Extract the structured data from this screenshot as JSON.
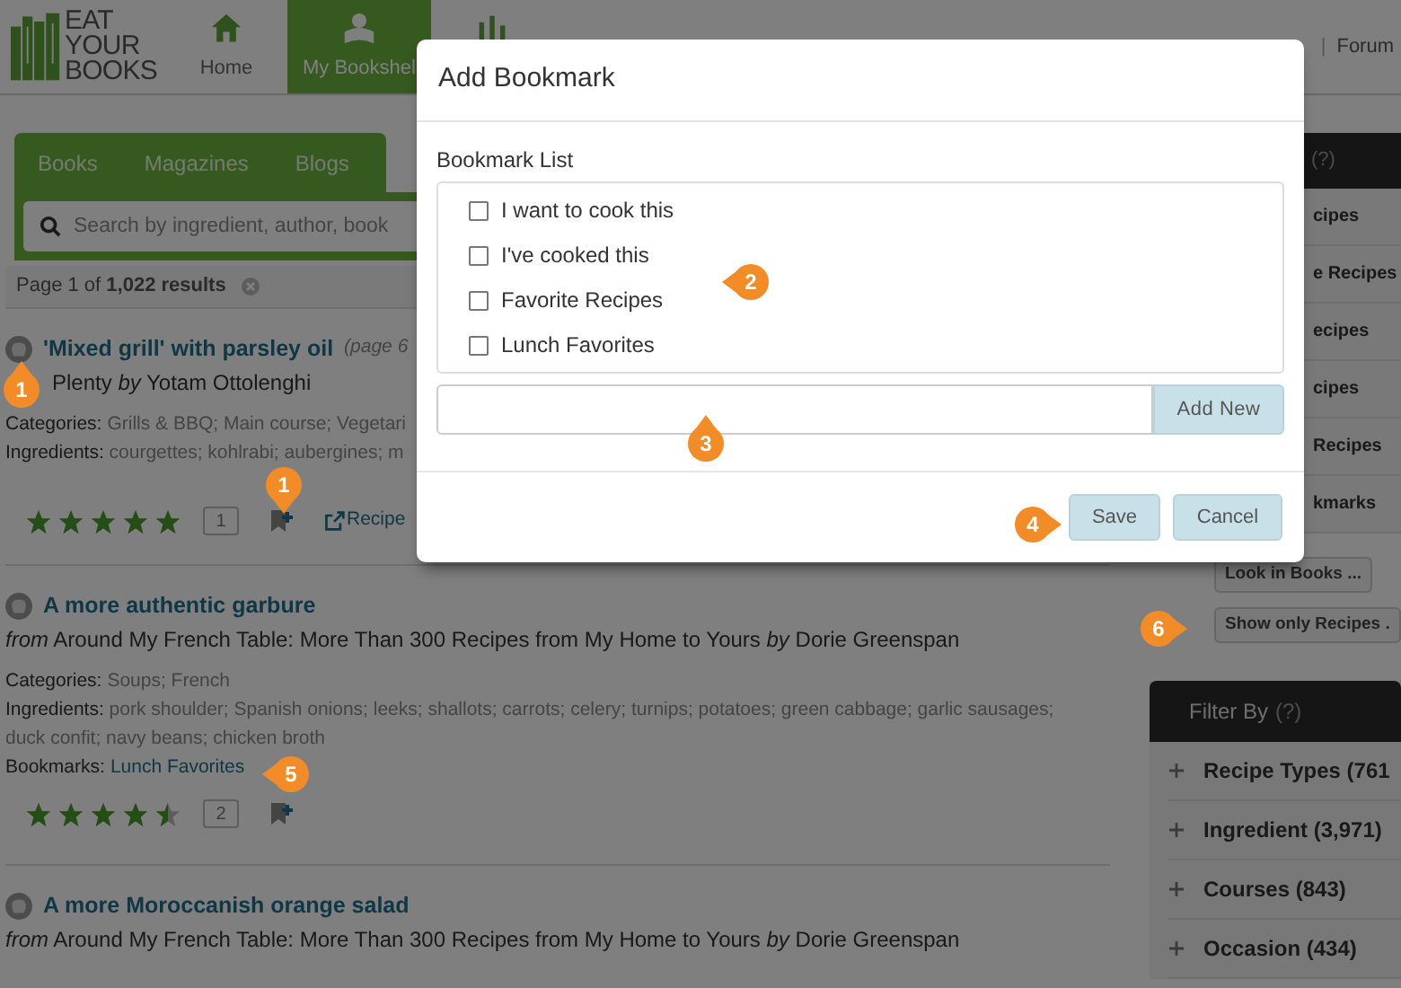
{
  "logo": {
    "lines": [
      "EAT",
      "YOUR",
      "BOOKS"
    ]
  },
  "nav": [
    {
      "label": "Home",
      "selected": false
    },
    {
      "label": "My Bookshel",
      "selected": true
    },
    {
      "selected": false
    }
  ],
  "header_links": {
    "separator": "|",
    "forum": "Forum"
  },
  "tabs": [
    {
      "label": "Books",
      "selected": false
    },
    {
      "label": "Magazines",
      "selected": false
    },
    {
      "label": "Blogs",
      "selected": false
    }
  ],
  "search": {
    "placeholder": "Search by ingredient, author, book"
  },
  "results_summary": "Page 1 of **1,022 results**",
  "results": [
    {
      "title": "'Mixed grill' with parsley oil",
      "page": "(page 6",
      "source": "Plenty *by* Yotam Ottolenghi",
      "categories_label": "Categories:",
      "categories": "Grills & BBQ; Main course; Vegetari",
      "ingredients_label": "Ingredients:",
      "ingredients": "courgettes; kohlrabi; aubergines; m",
      "stars": 5,
      "comments": "1",
      "recipe_link": "Recipe"
    },
    {
      "title": "A more authentic garbure",
      "source": "*from* Around My French Table: More Than 300 Recipes from My Home to Yours *by* Dorie Greenspan",
      "categories_label": "Categories:",
      "categories": "Soups; French",
      "ingredients_label": "Ingredients:",
      "ingredients": "pork shoulder; Spanish onions; leeks; shallots; carrots; celery; turnips; potatoes; green cabbage; garlic sausages; duck confit; navy beans; chicken broth",
      "bookmarks_label": "Bookmarks:",
      "bookmarks": "Lunch Favorites",
      "stars": 4.5,
      "comments": "2"
    },
    {
      "title": "A more Moroccanish orange salad",
      "source": "*from* Around My French Table: More Than 300 Recipes from My Home to Yours *by* Dorie Greenspan"
    }
  ],
  "sidebar": {
    "header": "(?)",
    "items": [
      "cipes",
      "e Recipes",
      "ecipes",
      "cipes",
      "Recipes",
      "kmarks"
    ],
    "buttons": [
      "Look in Books ...",
      "Show only Recipes ."
    ],
    "filter": {
      "title": "Filter By",
      "help": "(?)",
      "groups": [
        {
          "label": "Recipe Types (761",
          "expanded": false
        },
        {
          "label": "Ingredient (3,971)",
          "expanded": false
        },
        {
          "label": "Courses (843)",
          "expanded": false
        },
        {
          "label": "Occasion (434)",
          "expanded": false
        }
      ]
    }
  },
  "dialog": {
    "title": "Add Bookmark",
    "list_label": "Bookmark List",
    "lists": [
      {
        "label": "I want to cook this",
        "checked": false
      },
      {
        "label": "I've cooked this",
        "checked": false
      },
      {
        "label": "Favorite Recipes",
        "checked": false
      },
      {
        "label": "Lunch Favorites",
        "checked": false
      }
    ],
    "add_button": "Add New",
    "save_button": "Save",
    "cancel_button": "Cancel"
  },
  "callouts": [
    {
      "number": "1"
    },
    {
      "number": "1"
    },
    {
      "number": "2"
    },
    {
      "number": "3"
    },
    {
      "number": "4"
    },
    {
      "number": "5"
    },
    {
      "number": "6"
    }
  ]
}
